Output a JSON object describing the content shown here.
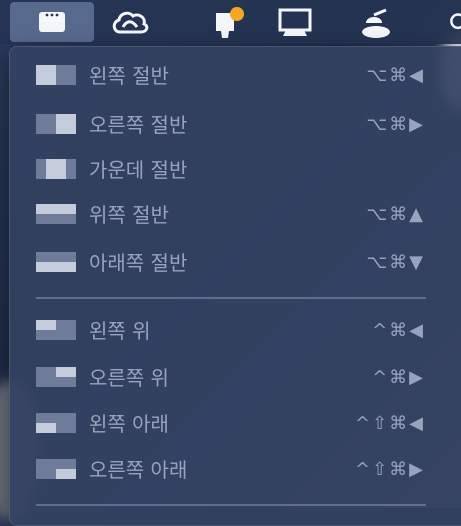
{
  "menubar": {
    "icons": [
      {
        "name": "window-menu-icon",
        "active": true
      },
      {
        "name": "creative-cloud-icon",
        "active": false
      },
      {
        "name": "notification-tray-icon",
        "active": false
      },
      {
        "name": "display-icon",
        "active": false
      },
      {
        "name": "lamp-icon",
        "active": false
      }
    ]
  },
  "menu": {
    "group1": [
      {
        "label": "왼쪽 절반",
        "shortcut": "⌥⌘◀",
        "snap": "left-half"
      },
      {
        "label": "오른쪽 절반",
        "shortcut": "⌥⌘▶",
        "snap": "right-half"
      },
      {
        "label": "가운데 절반",
        "shortcut": "",
        "snap": "center-half"
      },
      {
        "label": "위쪽 절반",
        "shortcut": "⌥⌘▲",
        "snap": "top-half"
      },
      {
        "label": "아래쪽 절반",
        "shortcut": "⌥⌘▼",
        "snap": "bottom-half"
      }
    ],
    "group2": [
      {
        "label": "왼쪽 위",
        "shortcut": "^⌘◀",
        "snap": "top-left"
      },
      {
        "label": "오른쪽 위",
        "shortcut": "^⌘▶",
        "snap": "top-right"
      },
      {
        "label": "왼쪽 아래",
        "shortcut": "^⇧⌘◀",
        "snap": "bottom-left"
      },
      {
        "label": "오른쪽 아래",
        "shortcut": "^⇧⌘▶",
        "snap": "bottom-right"
      }
    ]
  },
  "colors": {
    "menu_bg": "#34425f",
    "text": "#98a4bd",
    "icon_dim": "#6e7c99",
    "icon_lit": "#c4ccdc",
    "badge": "#f5a623"
  }
}
